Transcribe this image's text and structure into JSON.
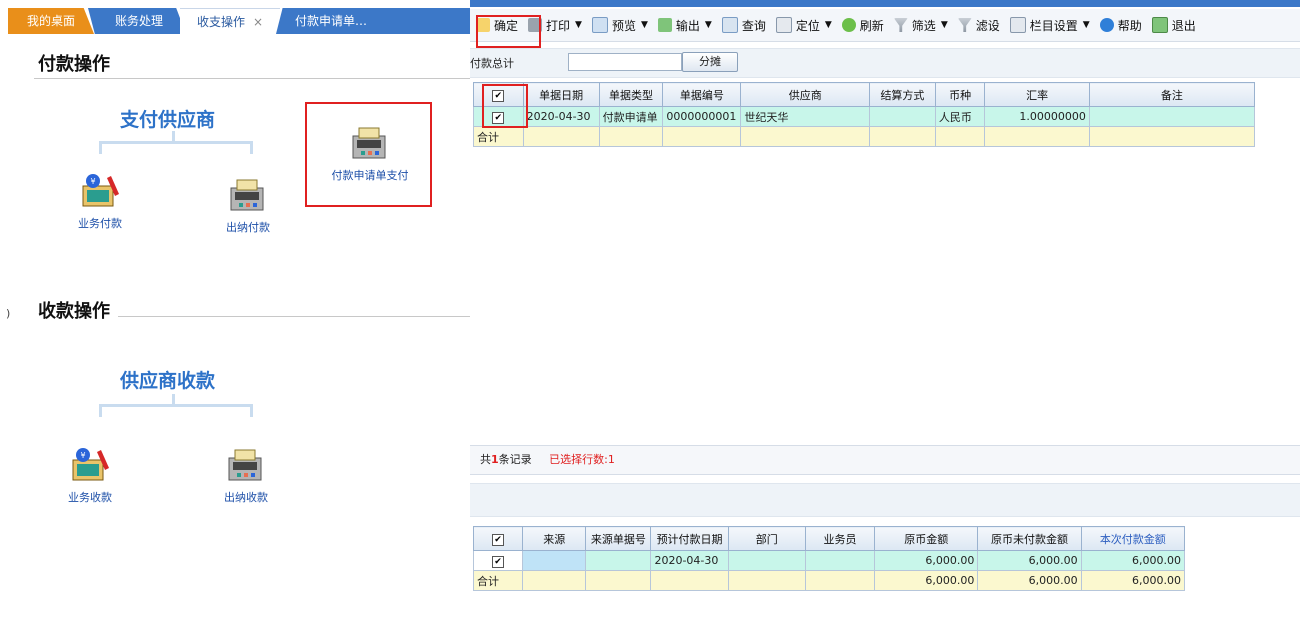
{
  "tabs": {
    "home": "我的桌面",
    "business": "账务处理",
    "active": "收支操作",
    "active_close": "×",
    "payment_request": "付款申请单…"
  },
  "left": {
    "pay_section_title": "付款操作",
    "pay_group_title": "支付供应商",
    "pay_business_label": "业务付款",
    "pay_cashier_label": "出纳付款",
    "pay_request_label": "付款申请单支付",
    "receive_section_title": "收款操作",
    "receive_group_title": "供应商收款",
    "receive_business_label": "业务收款",
    "receive_cashier_label": "出纳收款",
    "edge_marker": ")"
  },
  "toolbar": {
    "confirm": "确定",
    "print": "打印",
    "preview": "预览",
    "output": "输出",
    "query": "查询",
    "locate": "定位",
    "refresh": "刷新",
    "filter": "筛选",
    "filter_set": "滤设",
    "column_settings": "栏目设置",
    "help": "帮助",
    "exit": "退出"
  },
  "summary": {
    "label": "付款总计",
    "value": "",
    "split_button": "分摊"
  },
  "upper_table": {
    "headers": [
      "单据日期",
      "单据类型",
      "单据编号",
      "供应商",
      "结算方式",
      "币种",
      "汇率",
      "备注"
    ],
    "rows": [
      [
        "2020-04-30",
        "付款申请单",
        "0000000001",
        "世纪天华",
        "",
        "人民币",
        "1.00000000",
        ""
      ]
    ],
    "total_label": "合计"
  },
  "status": {
    "prefix": "共",
    "count": "1",
    "suffix": "条记录",
    "selected": "已选择行数:1"
  },
  "lower_table": {
    "headers": [
      "来源",
      "来源单据号",
      "预计付款日期",
      "部门",
      "业务员",
      "原币金额",
      "原币未付款金额",
      "本次付款金额"
    ],
    "rows": [
      [
        "",
        "",
        "2020-04-30",
        "",
        "",
        "6,000.00",
        "6,000.00",
        "6,000.00"
      ]
    ],
    "total_label": "合计",
    "totals": [
      "6,000.00",
      "6,000.00",
      "6,000.00"
    ]
  },
  "colors": {
    "tab_blue": "#3c78c8",
    "tab_orange": "#e98f1a",
    "group_title": "#2d72c8",
    "highlight_red": "#e02020",
    "selected_row": "#c8f6ea",
    "total_row": "#fbf8cf"
  },
  "icons": {
    "pay_business": "business-payment-icon",
    "pay_cashier": "cashier-payment-icon",
    "pay_request": "payment-request-icon",
    "receive_business": "business-receipt-icon",
    "receive_cashier": "cashier-receipt-icon"
  }
}
